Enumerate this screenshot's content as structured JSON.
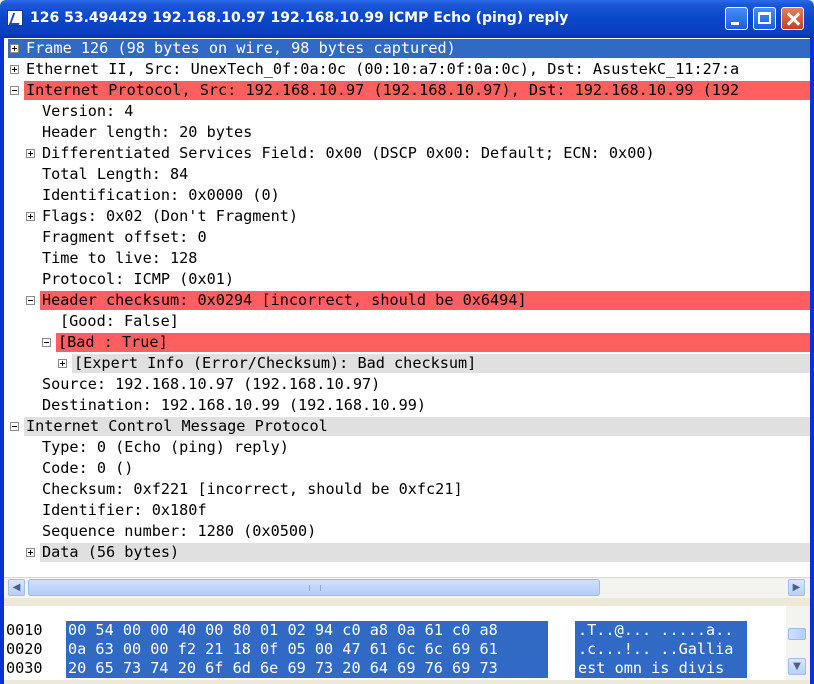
{
  "window": {
    "title": "126 53.494429 192.168.10.97 192.168.10.99 ICMP Echo (ping) reply"
  },
  "tree": {
    "rows": [
      "Frame 126 (98 bytes on wire, 98 bytes captured)",
      "Ethernet II, Src: UnexTech_0f:0a:0c (00:10:a7:0f:0a:0c), Dst: AsustekC_11:27:a",
      "Internet Protocol, Src: 192.168.10.97 (192.168.10.97), Dst: 192.168.10.99 (192",
      "Version: 4",
      "Header length: 20 bytes",
      "Differentiated Services Field: 0x00 (DSCP 0x00: Default; ECN: 0x00)",
      "Total Length: 84",
      "Identification: 0x0000 (0)",
      "Flags: 0x02 (Don't Fragment)",
      "Fragment offset: 0",
      "Time to live: 128",
      "Protocol: ICMP (0x01)",
      "Header checksum: 0x0294 [incorrect, should be 0x6494]",
      "[Good: False]",
      "[Bad : True]",
      "[Expert Info (Error/Checksum): Bad checksum]",
      "Source: 192.168.10.97 (192.168.10.97)",
      "Destination: 192.168.10.99 (192.168.10.99)",
      "Internet Control Message Protocol",
      "Type: 0 (Echo (ping) reply)",
      "Code: 0 ()",
      "Checksum: 0xf221 [incorrect, should be 0xfc21]",
      "Identifier: 0x180f",
      "Sequence number: 1280 (0x0500)",
      "Data (56 bytes)"
    ]
  },
  "hex": {
    "rows": [
      {
        "offset": "0010",
        "hex": "00 54 00 00 40 00 80 01  02 94 c0 a8 0a 61 c0 a8",
        "ascii": ".T..@... .....a.."
      },
      {
        "offset": "0020",
        "hex": "0a 63 00 00 f2 21 18 0f  05 00 47 61 6c 6c 69 61",
        "ascii": ".c...!.. ..Gallia"
      },
      {
        "offset": "0030",
        "hex": "20 65 73 74 20 6f 6d 6e  69 73 20 64 69 76 69 73",
        "ascii": " est omn is divis"
      }
    ]
  },
  "icons": {
    "app": "wireshark-icon",
    "minimize": "minimize-icon",
    "maximize": "maximize-icon",
    "close": "close-icon",
    "expand": "expand-icon",
    "collapse": "collapse-icon"
  },
  "colors": {
    "selection": "#316ac5",
    "error_highlight": "#ff5f5f",
    "subtree_highlight": "#e0e0e0",
    "title_bar": "#0a46c8"
  }
}
